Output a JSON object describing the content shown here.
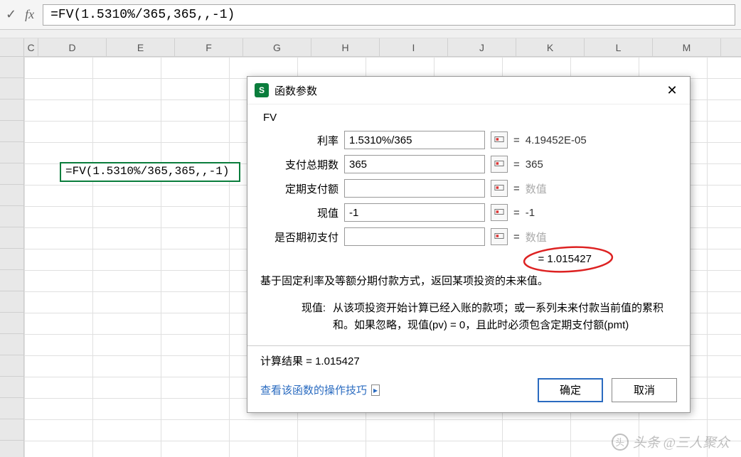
{
  "formula_bar": {
    "fx_label": "fx",
    "formula": "=FV(1.5310%/365,365,,-1)"
  },
  "columns": [
    "C",
    "D",
    "E",
    "F",
    "G",
    "H",
    "I",
    "J",
    "K",
    "L",
    "M"
  ],
  "active_cell": {
    "text": "=FV(1.5310%/365,365,,-1)"
  },
  "dialog": {
    "title": "函数参数",
    "func_name": "FV",
    "params": [
      {
        "label": "利率",
        "value": "1.5310%/365",
        "result": "4.19452E-05",
        "placeholder": false
      },
      {
        "label": "支付总期数",
        "value": "365",
        "result": "365",
        "placeholder": false
      },
      {
        "label": "定期支付额",
        "value": "",
        "result": "数值",
        "placeholder": true
      },
      {
        "label": "现值",
        "value": "-1",
        "result": "-1",
        "placeholder": false
      },
      {
        "label": "是否期初支付",
        "value": "",
        "result": "数值",
        "placeholder": true
      }
    ],
    "formula_result": "= 1.015427",
    "description": "基于固定利率及等额分期付款方式，返回某项投资的未来值。",
    "param_help_label": "现值:",
    "param_help_text": "从该项投资开始计算已经入账的款项；或一系列未来付款当前值的累积和。如果忽略，现值(pv) = 0，且此时必须包含定期支付额(pmt)",
    "calc_result_label": "计算结果 = 1.015427",
    "help_link": "查看该函数的操作技巧",
    "ok_label": "确定",
    "cancel_label": "取消"
  },
  "watermark": "头条 @三人聚众"
}
